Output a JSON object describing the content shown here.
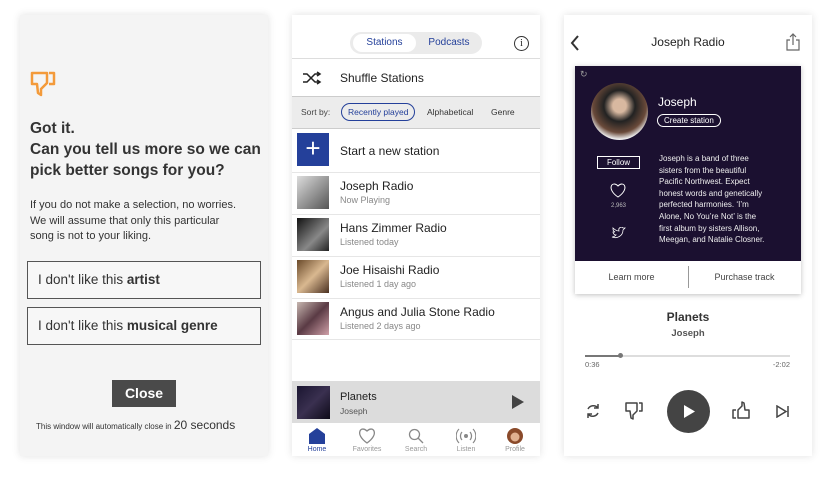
{
  "feedback": {
    "icon": "thumbs-down-icon",
    "title_line1": "Got it.",
    "title_line2": "Can you tell us more so we can",
    "title_line3": "pick better songs for you?",
    "desc_line1": "If you do not make a selection, no worries.",
    "desc_line2": "We will assume that only this particular",
    "desc_line3": "song is not to your liking.",
    "option1_prefix": "I don't like this ",
    "option1_bold": "artist",
    "option2_prefix": "I don't like this ",
    "option2_bold": "musical genre",
    "close_label": "Close",
    "countdown_text": "This window will automatically close in",
    "countdown_value": "20 seconds",
    "accent": "#f39a3a"
  },
  "stations": {
    "tabs": [
      "Stations",
      "Podcasts"
    ],
    "active_tab": "Stations",
    "shuffle_label": "Shuffle Stations",
    "sort_label": "Sort by:",
    "sort_options": [
      "Recently played",
      "Alphabetical",
      "Genre"
    ],
    "active_sort": "Recently played",
    "new_station_label": "Start a new station",
    "items": [
      {
        "title": "Joseph Radio",
        "subtitle": "Now Playing"
      },
      {
        "title": "Hans Zimmer Radio",
        "subtitle": "Listened today"
      },
      {
        "title": "Joe Hisaishi Radio",
        "subtitle": "Listened 1 day ago"
      },
      {
        "title": "Angus and Julia Stone Radio",
        "subtitle": "Listened 2 days ago"
      }
    ],
    "mini_player": {
      "title": "Planets",
      "artist": "Joseph"
    },
    "nav": [
      "Home",
      "Favorites",
      "Search",
      "Listen",
      "Profile"
    ],
    "active_nav": "Home",
    "accent": "#24409a"
  },
  "player": {
    "title": "Joseph Radio",
    "artist_card": {
      "name": "Joseph",
      "create_label": "Create station",
      "follow_label": "Follow",
      "likes": "2,963",
      "bio_lines": [
        "Joseph is a band of three",
        "sisters from the beautiful",
        "Pacific Northwest. Expect",
        "honest words and genetically",
        "perfected harmonies.  ‘I’m",
        "Alone, No You’re Not’ is the",
        "first album by sisters Allison,",
        "Meegan, and Natalie Closner."
      ],
      "learn_more": "Learn more",
      "purchase": "Purchase track"
    },
    "track": "Planets",
    "track_artist": "Joseph",
    "elapsed": "0:36",
    "remaining": "-2:02",
    "progress": 0.17,
    "card_bg": "#1b1030"
  }
}
